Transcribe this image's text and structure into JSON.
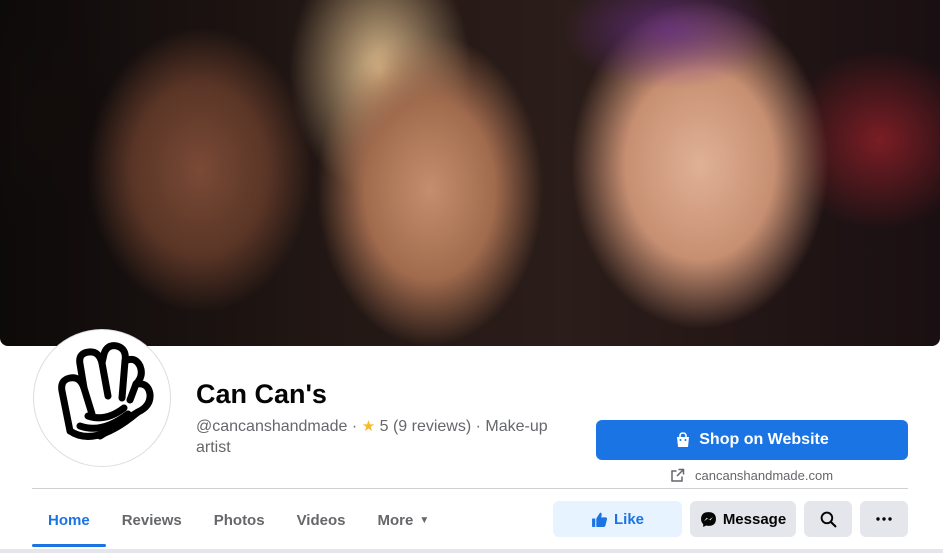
{
  "cover": {
    "description_icon": "cover-photo"
  },
  "profile": {
    "name": "Can Can's",
    "handle": "@cancanshandmade",
    "separator": "·",
    "rating": "5",
    "reviews": "(9 reviews)",
    "category": "Make-up artist"
  },
  "shop": {
    "label": "Shop on Website",
    "link": "cancanshandmade.com"
  },
  "tabs": [
    {
      "label": "Home"
    },
    {
      "label": "Reviews"
    },
    {
      "label": "Photos"
    },
    {
      "label": "Videos"
    },
    {
      "label": "More"
    }
  ],
  "actions": {
    "like": "Like",
    "message": "Message"
  },
  "icons": {
    "shop": "shopping-bag-icon",
    "external": "external-link-icon",
    "like": "thumbs-up-icon",
    "message": "messenger-icon",
    "search": "search-icon",
    "more": "more-dots-icon",
    "star": "star-icon"
  },
  "colors": {
    "accent": "#1b74e4",
    "star": "#f7b928",
    "secondary_text": "#65676b"
  }
}
